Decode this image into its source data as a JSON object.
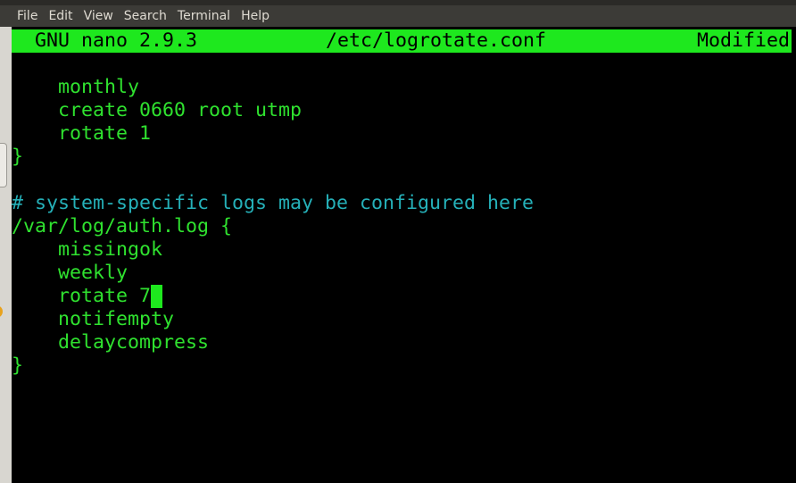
{
  "menubar": {
    "items": [
      "File",
      "Edit",
      "View",
      "Search",
      "Terminal",
      "Help"
    ]
  },
  "nano": {
    "version_label": "GNU nano 2.9.3",
    "filename": "/etc/logrotate.conf",
    "status": "Modified"
  },
  "editor": {
    "lines": [
      {
        "text": "    monthly",
        "kind": "code"
      },
      {
        "text": "    create 0660 root utmp",
        "kind": "code"
      },
      {
        "text": "    rotate 1",
        "kind": "code"
      },
      {
        "text": "}",
        "kind": "code"
      },
      {
        "text": "",
        "kind": "code"
      },
      {
        "text": "# system-specific logs may be configured here",
        "kind": "comment"
      },
      {
        "text": "/var/log/auth.log {",
        "kind": "code"
      },
      {
        "text": "    missingok",
        "kind": "code"
      },
      {
        "text": "    weekly",
        "kind": "code"
      },
      {
        "text": "    rotate 7",
        "kind": "code",
        "cursor": true
      },
      {
        "text": "    notifempty",
        "kind": "code"
      },
      {
        "text": "    delaycompress",
        "kind": "code"
      },
      {
        "text": "}",
        "kind": "code"
      }
    ]
  },
  "colors": {
    "terminal_bg": "#000000",
    "text_green": "#2fe12f",
    "comment_cyan": "#25b0b8",
    "titlebar_green": "#1ee81e",
    "menubar_bg": "#3c3b37",
    "accent_orange": "#e8a21c"
  }
}
